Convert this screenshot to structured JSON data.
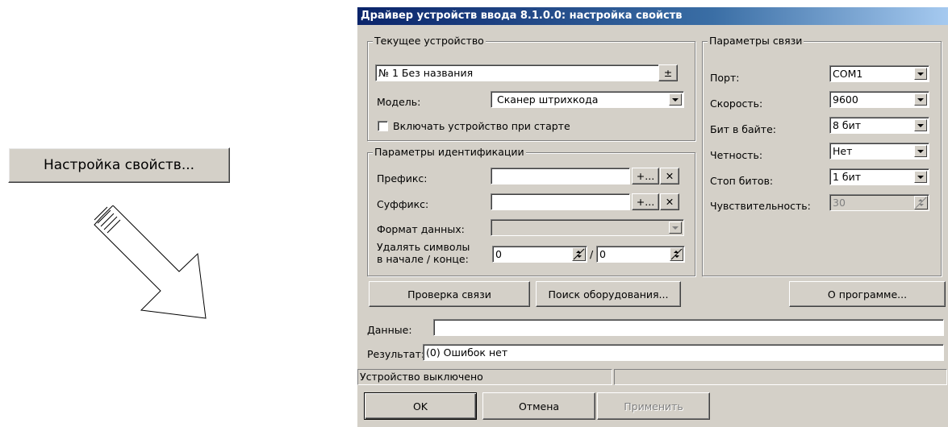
{
  "standalone_button": {
    "label": "Настройка свойств..."
  },
  "arrow_icon": "big-outline-arrow-down-right",
  "dialog": {
    "title": "Драйвер устройств ввода 8.1.0.0: настройка свойств",
    "current_device": {
      "group_title": "Текущее устройство",
      "device_select": "№ 1 Без названия",
      "plusminus_label": "±",
      "model_label": "Модель:",
      "model_value": "Сканер штрихкода",
      "startup_checkbox_label": "Включать устройство при старте",
      "startup_checked": false
    },
    "identification": {
      "group_title": "Параметры идентификации",
      "prefix_label": "Префикс:",
      "prefix_value": "",
      "suffix_label": "Суффикс:",
      "suffix_value": "",
      "add_label": "+...",
      "clear_label": "✕",
      "format_label": "Формат данных:",
      "format_value": "",
      "strip_label_line1": "Удалять символы",
      "strip_label_line2": "в начале / конце:",
      "strip_start": "0",
      "strip_separator": "/",
      "strip_end": "0"
    },
    "connection": {
      "group_title": "Параметры связи",
      "port_label": "Порт:",
      "port_value": "COM1",
      "speed_label": "Скорость:",
      "speed_value": "9600",
      "bits_label": "Бит в байте:",
      "bits_value": "8 бит",
      "parity_label": "Четность:",
      "parity_value": "Нет",
      "stopbits_label": "Стоп битов:",
      "stopbits_value": "1 бит",
      "sensitivity_label": "Чувствительность:",
      "sensitivity_value": "30"
    },
    "actions": {
      "check_connection": "Проверка связи",
      "search_hardware": "Поиск оборудования...",
      "about": "О программе..."
    },
    "data_label": "Данные:",
    "data_value": "",
    "result_label": "Результат:",
    "result_value": "(0) Ошибок нет",
    "status_text": "Устройство выключено",
    "status_text2": "",
    "footer": {
      "ok": "OK",
      "cancel": "Отмена",
      "apply": "Применить"
    }
  }
}
